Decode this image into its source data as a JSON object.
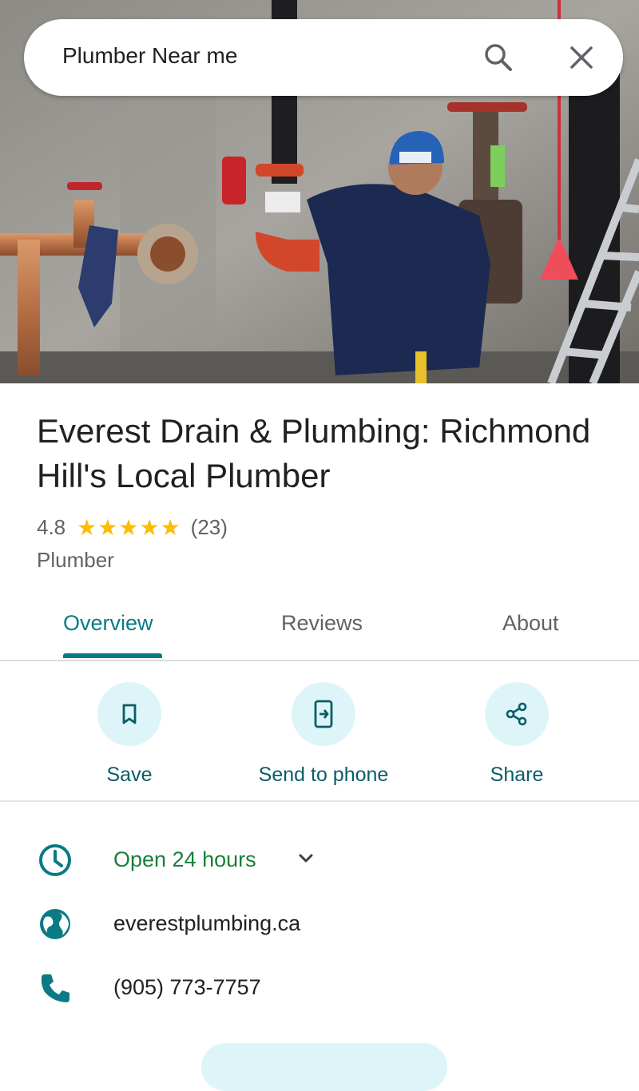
{
  "search": {
    "query": "Plumber Near me",
    "search_icon": "search-icon",
    "close_icon": "close-icon"
  },
  "place": {
    "name": "Everest Drain & Plumbing: Richmond Hill's Local Plumber",
    "rating": "4.8",
    "stars": "★★★★★",
    "review_count": "(23)",
    "category": "Plumber"
  },
  "tabs": [
    {
      "label": "Overview",
      "active": true
    },
    {
      "label": "Reviews",
      "active": false
    },
    {
      "label": "About",
      "active": false
    }
  ],
  "actions": [
    {
      "label": "Save",
      "icon": "bookmark-icon"
    },
    {
      "label": "Send to phone",
      "icon": "send-to-phone-icon"
    },
    {
      "label": "Share",
      "icon": "share-icon"
    }
  ],
  "info": {
    "hours": "Open 24 hours",
    "website": "everestplumbing.ca",
    "phone": "(905) 773-7757"
  },
  "colors": {
    "accent": "#0b7a85",
    "open_status": "#188038",
    "star": "#fbbc04",
    "action_bg": "#ddf5f9"
  }
}
